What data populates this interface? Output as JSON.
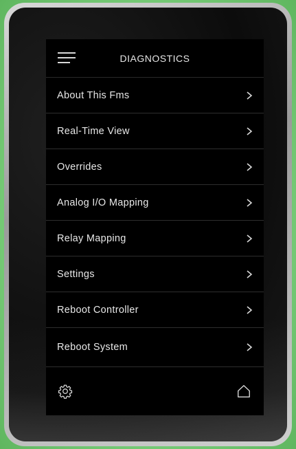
{
  "header": {
    "title": "DIAGNOSTICS",
    "menu_icon": "hamburger-menu-icon"
  },
  "menu": {
    "items": [
      {
        "label": "About This Fms"
      },
      {
        "label": "Real-Time View"
      },
      {
        "label": "Overrides"
      },
      {
        "label": "Analog I/O Mapping"
      },
      {
        "label": "Relay Mapping"
      },
      {
        "label": "Settings"
      },
      {
        "label": "Reboot Controller"
      },
      {
        "label": "Reboot System"
      }
    ],
    "chevron_icon": "chevron-right-icon"
  },
  "footer": {
    "left_icon": "gear-icon",
    "right_icon": "home-icon"
  },
  "colors": {
    "screen_bg": "#000000",
    "text": "#e8e8e8",
    "divider": "#2e2e2e",
    "bezel_glow": "#7fcf7f"
  }
}
